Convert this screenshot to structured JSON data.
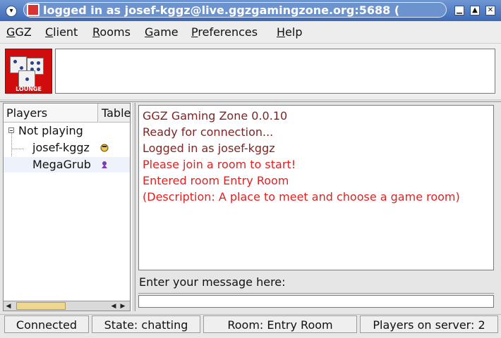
{
  "window": {
    "title": "logged in as josef-kggz@live.ggzgamingzone.org:5688 (",
    "minimize_label": "▁",
    "maximize_label": "▲",
    "close_label": "✕"
  },
  "menu": {
    "items": [
      {
        "label": "GGZ",
        "accelerator": "Z"
      },
      {
        "label": "Client",
        "accelerator": "C"
      },
      {
        "label": "Rooms",
        "accelerator": "R"
      },
      {
        "label": "Game",
        "accelerator": "G"
      },
      {
        "label": "Preferences",
        "accelerator": "P"
      },
      {
        "label": "Help",
        "accelerator": "H"
      }
    ]
  },
  "lounge": {
    "label": "LOUNGE"
  },
  "tabs": {
    "players": "Players",
    "tables": "Table"
  },
  "tree": {
    "group_label": "Not playing",
    "players": [
      {
        "name": "josef-kggz",
        "icon": "player-status-icon"
      },
      {
        "name": "MegaGrub",
        "icon": "player-status-icon"
      }
    ]
  },
  "chat": {
    "lines": [
      {
        "text": "GGZ Gaming Zone 0.0.10",
        "color": "#7f2424"
      },
      {
        "text": "Ready for connection...",
        "color": "#7f2424"
      },
      {
        "text": "Logged in as josef-kggz",
        "color": "#7f2424"
      },
      {
        "text": "Please join a room to start!",
        "color": "#7f2424"
      },
      {
        "text": "Entered room Entry Room",
        "color": "#e32020"
      },
      {
        "text": "(Description: A place to meet and choose a game room)",
        "color": "#e32020"
      }
    ]
  },
  "message": {
    "label": "Enter your message here:",
    "value": ""
  },
  "status": {
    "connection": "Connected",
    "state": "State: chatting",
    "room": "Room: Entry Room",
    "players": "Players on server: 2"
  },
  "colors": {
    "title_bar": "#4f7bc3",
    "chat_dark_red": "#7f2424",
    "chat_bright_red": "#e32020",
    "lounge_red": "#d10c0c"
  }
}
